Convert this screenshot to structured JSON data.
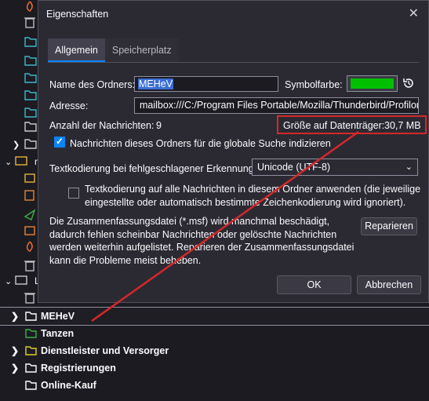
{
  "tree": {
    "folders": [
      {
        "label": "MEHeV",
        "color": "#ffffff",
        "expandable": true
      },
      {
        "label": "Tanzen",
        "color": "#3cb043",
        "expandable": false
      },
      {
        "label": "Dienstleister und Versorger",
        "color": "#e0d020",
        "expandable": true
      },
      {
        "label": "Registrierungen",
        "color": "#ffffff",
        "expandable": true
      },
      {
        "label": "Online-Kauf",
        "color": "#ffffff",
        "expandable": false
      }
    ],
    "partial_label": "L"
  },
  "dialog": {
    "title": "Eigenschaften",
    "tabs": [
      "Allgemein",
      "Speicherplatz"
    ],
    "name_label": "Name des Ordners:",
    "name_value": "MEHeV",
    "icon_color_label": "Symbolfarbe:",
    "icon_color": "#00c000",
    "address_label": "Adresse:",
    "address_value": "mailbox:///C:/Program Files Portable/Mozilla/Thunderbird/Profilor",
    "message_count_label": "Anzahl der Nachrichten:",
    "message_count": "9",
    "disk_size_label": "Größe auf Datenträger:",
    "disk_size": "30,7 MB",
    "global_search_label": "Nachrichten dieses Ordners für die globale Suche indizieren",
    "global_search_checked": true,
    "fallback_encoding_label": "Textkodierung bei fehlgeschlagener Erkennung:",
    "fallback_encoding_value": "Unicode (UTF-8)",
    "apply_encoding_label": "Textkodierung auf alle Nachrichten in diesem Ordner anwenden (die jeweilige\neingestellte oder automatisch bestimmte Zeichenkodierung wird ignoriert).",
    "apply_encoding_checked": false,
    "summary_text": "Die Zusammenfassungsdatei (*.msf) wird manchmal beschädigt,\ndadurch fehlen scheinbar Nachrichten oder gelöschte Nachrichten\nwerden weiterhin aufgelistet. Reparieren der Zusammenfassungsdatei\nkann die Probleme meist beheben.",
    "repair_button": "Reparieren",
    "ok_button": "OK",
    "cancel_button": "Abbrechen"
  },
  "colors": {
    "highlight_red": "#d4282a",
    "accent_blue": "#0b84ff"
  }
}
